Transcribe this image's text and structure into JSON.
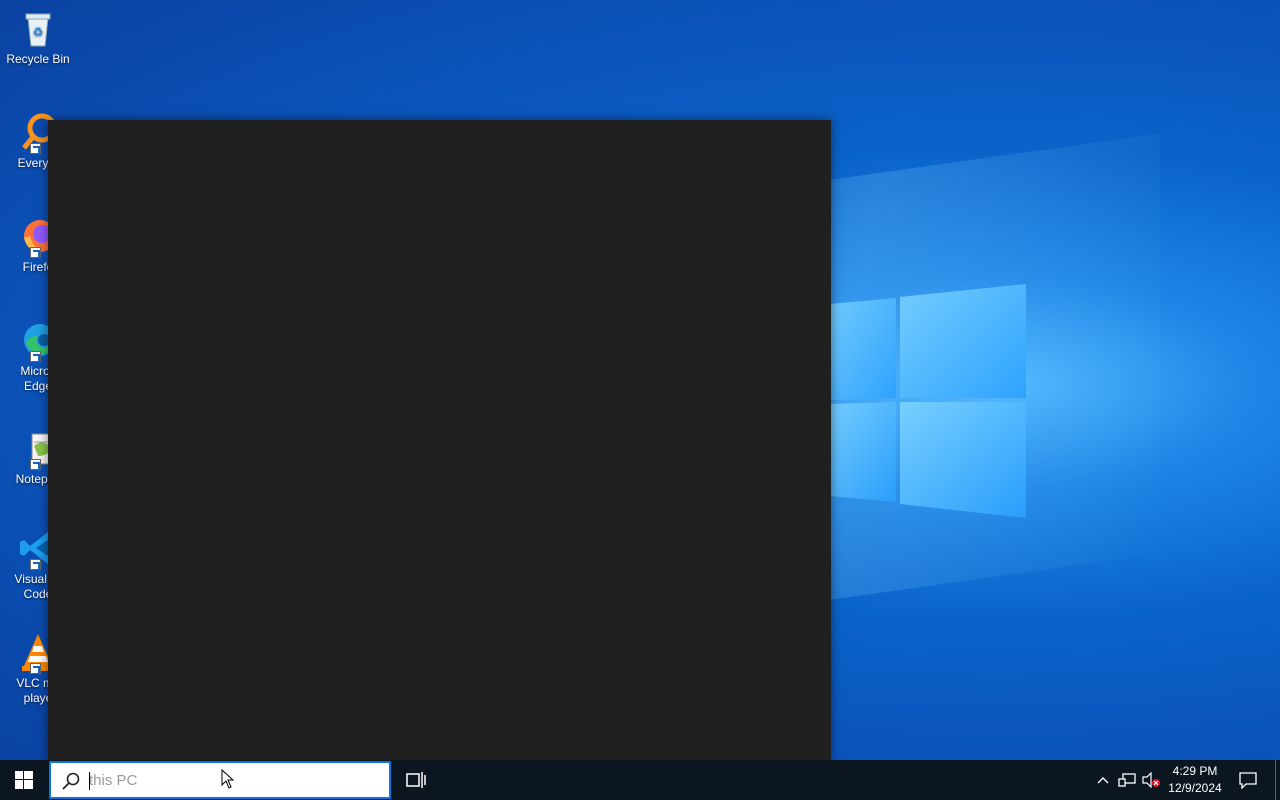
{
  "desktop": {
    "icons": [
      {
        "label": "Recycle Bin",
        "icon": "recycle-bin-icon"
      },
      {
        "label": "Everyth",
        "icon": "everything-search-icon"
      },
      {
        "label": "Firefo",
        "icon": "firefox-icon"
      },
      {
        "label": "Micros\nEdge",
        "icon": "edge-icon"
      },
      {
        "label": "Notepac",
        "icon": "notepad-plus-plus-icon"
      },
      {
        "label": "Visual St\nCode",
        "icon": "vscode-icon"
      },
      {
        "label": "VLC me\nplaye",
        "icon": "vlc-icon"
      }
    ]
  },
  "taskbar": {
    "search": {
      "value": "this PC",
      "icon": "search-icon"
    },
    "clock": {
      "time": "4:29 PM",
      "date": "12/9/2024"
    },
    "tray_icons": [
      "chevron-up-icon",
      "network-icon",
      "volume-muted-icon",
      "notification-icon"
    ]
  },
  "colors": {
    "desktop_accent": "#0a63c9",
    "taskbar_bg": "#0c1621",
    "start_panel_bg": "#202020",
    "search_border": "#0a74d8"
  }
}
